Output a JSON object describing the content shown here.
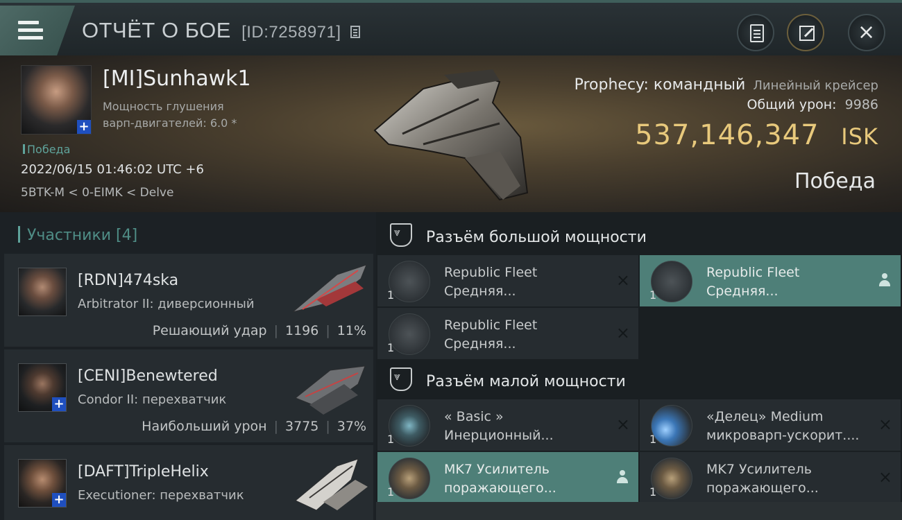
{
  "header": {
    "title": "ОТЧЁТ О БОЕ",
    "kill_id": "[ID:7258971]"
  },
  "victim": {
    "name": "[MI]Sunhawk1",
    "attr_line1": "Мощность глушения",
    "attr_line2": "варп-двигателей: 6.0 *",
    "tag": "Победа",
    "datetime": "2022/06/15 01:46:02 UTC +6",
    "location": "5BTK-M < 0-EIMK < Delve",
    "ship_name": "Prophecy: командный",
    "ship_class": "Линейный крейсер",
    "damage_label": "Общий урон:",
    "damage_value": "9986",
    "isk_value": "537,146,347",
    "isk_unit": "ISK",
    "result": "Победа"
  },
  "participants": {
    "header": "Участники [4]",
    "items": [
      {
        "name": "[RDN]474ska",
        "ship": "Arbitrator II: диверсионный",
        "stat_label": "Решающий удар",
        "damage": "1196",
        "percent": "11%"
      },
      {
        "name": "[CENI]Benewtered",
        "ship": "Condor II: перехватчик",
        "stat_label": "Наибольший урон",
        "damage": "3775",
        "percent": "37%"
      },
      {
        "name": "[DAFT]TripleHelix",
        "ship": "Executioner: перехватчик",
        "stat_label": "",
        "damage": "",
        "percent": ""
      }
    ]
  },
  "fittings": {
    "high_slot_label": "Разъём большой мощности",
    "low_slot_label": "Разъём малой мощности",
    "high": [
      {
        "line1": "Republic Fleet",
        "line2": "Средняя...",
        "qty": "1",
        "status": "destroyed"
      },
      {
        "line1": "Republic Fleet",
        "line2": "Средняя...",
        "qty": "1",
        "status": "dropped"
      },
      {
        "line1": "Republic Fleet",
        "line2": "Средняя...",
        "qty": "1",
        "status": "destroyed"
      }
    ],
    "low": [
      {
        "line1": "« Basic »",
        "line2": "Инерционный...",
        "qty": "1",
        "status": "destroyed"
      },
      {
        "line1": "«Делец» Medium",
        "line2": "микроварп-ускорит....",
        "qty": "1",
        "status": "destroyed"
      },
      {
        "line1": "MK7 Усилитель",
        "line2": "поражающего...",
        "qty": "1",
        "status": "dropped"
      },
      {
        "line1": "MK7 Усилитель",
        "line2": "поражающего...",
        "qty": "1",
        "status": "destroyed"
      }
    ]
  },
  "icons": {
    "destroyed": "×",
    "plus": "+"
  },
  "colors": {
    "accent": "#5fa39b",
    "isk": "#e8c97c",
    "active_row": "#4e7f78"
  }
}
